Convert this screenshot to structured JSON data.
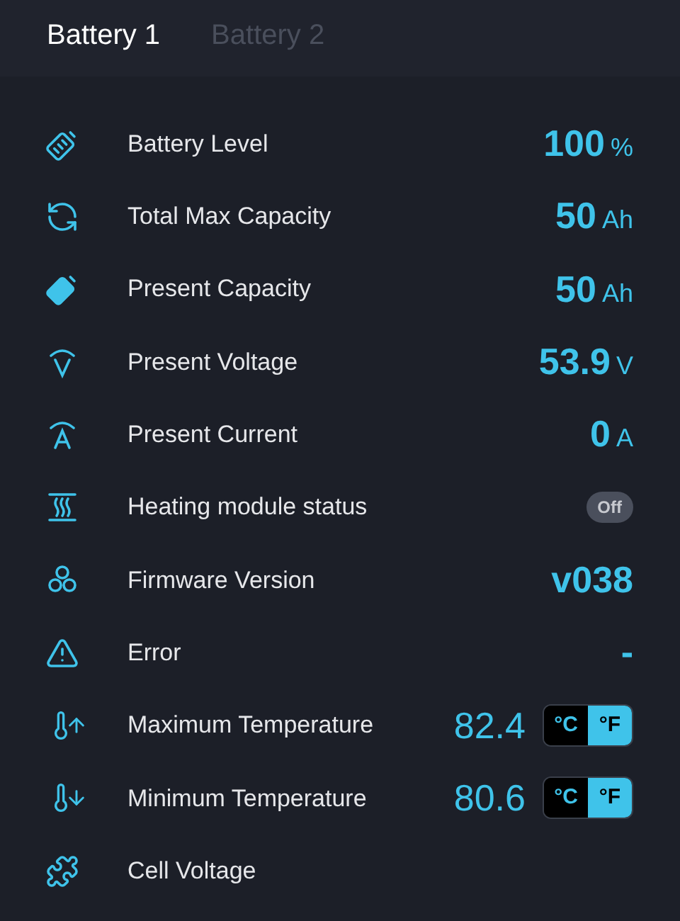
{
  "tabs": [
    {
      "label": "Battery 1",
      "selected": true
    },
    {
      "label": "Battery 2",
      "selected": false
    }
  ],
  "rows": [
    {
      "kind": "reading",
      "label": "Battery Level",
      "value": "100",
      "unit": "%"
    },
    {
      "kind": "reading",
      "label": "Total Max Capacity",
      "value": "50",
      "unit": "Ah"
    },
    {
      "kind": "reading",
      "label": "Present Capacity",
      "value": "50",
      "unit": "Ah"
    },
    {
      "kind": "reading",
      "label": "Present Voltage",
      "value": "53.9",
      "unit": "V"
    },
    {
      "kind": "reading",
      "label": "Present Current",
      "value": "0",
      "unit": "A"
    },
    {
      "kind": "switch",
      "label": "Heating module status",
      "status": "Off",
      "on": false
    },
    {
      "kind": "reading",
      "label": "Firmware Version",
      "value": "v038"
    },
    {
      "kind": "reading",
      "label": "Error",
      "value": "-"
    },
    {
      "kind": "temperature",
      "label": "Maximum Temperature",
      "value": "82.4",
      "units": [
        {
          "label": "°C",
          "selected": false
        },
        {
          "label": "°F",
          "selected": true
        }
      ]
    },
    {
      "kind": "temperature",
      "label": "Minimum Temperature",
      "value": "80.6",
      "units": [
        {
          "label": "°C",
          "selected": false
        },
        {
          "label": "°F",
          "selected": true
        }
      ]
    },
    {
      "kind": "plain",
      "label": "Cell Voltage"
    }
  ]
}
